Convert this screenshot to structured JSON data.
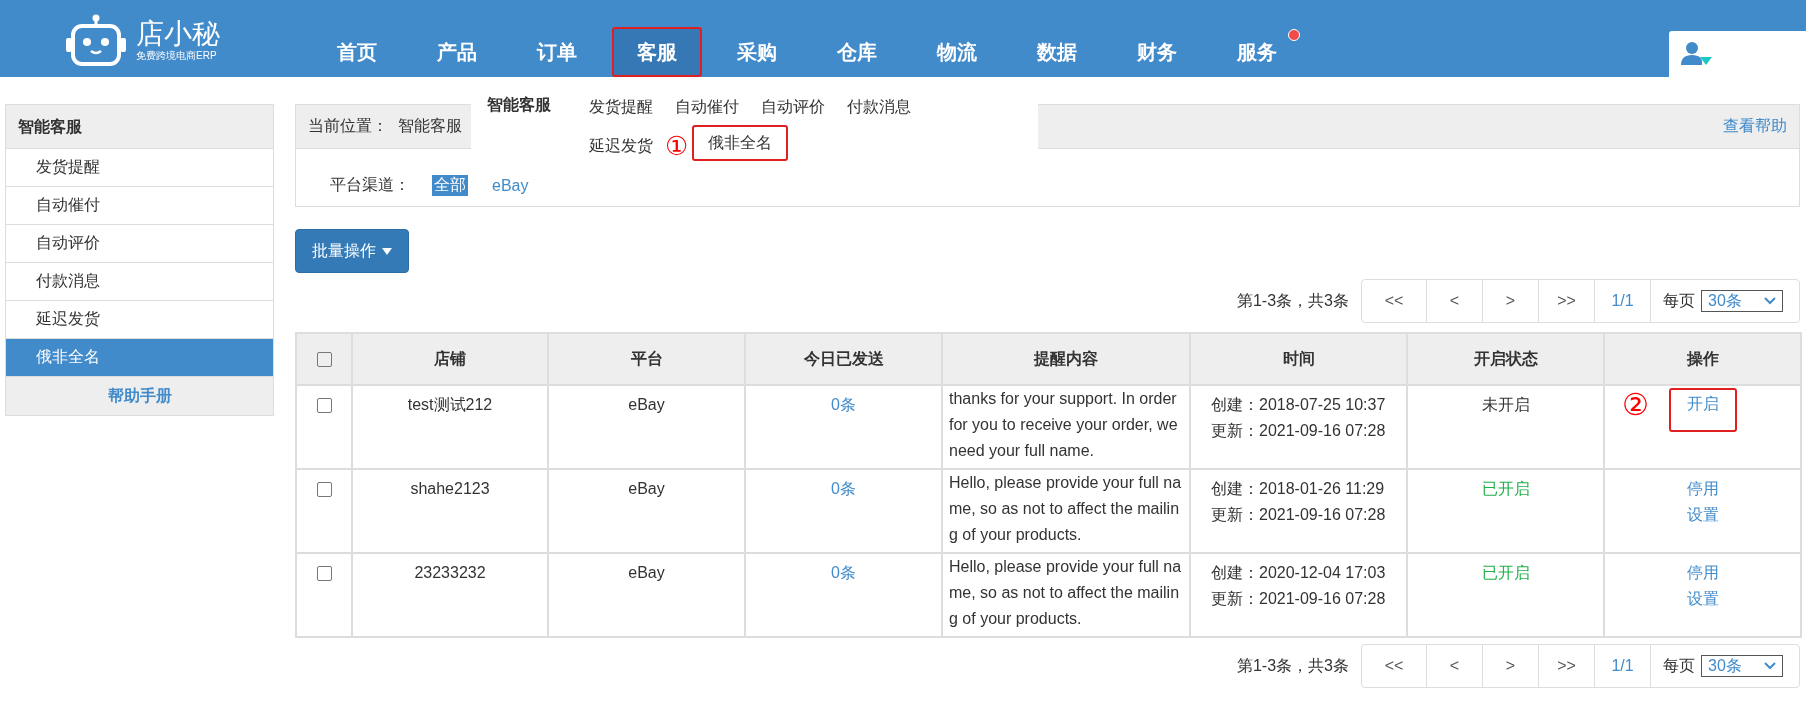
{
  "header": {
    "logo": {
      "name": "店小秘",
      "tagline": "免费跨境电商ERP"
    },
    "nav": [
      {
        "label": "首页",
        "selected": false,
        "badge": false,
        "highlight": false
      },
      {
        "label": "产品",
        "selected": false,
        "badge": false,
        "highlight": false
      },
      {
        "label": "订单",
        "selected": false,
        "badge": false,
        "highlight": false
      },
      {
        "label": "客服",
        "selected": true,
        "badge": false,
        "highlight": true
      },
      {
        "label": "采购",
        "selected": false,
        "badge": false,
        "highlight": false
      },
      {
        "label": "仓库",
        "selected": false,
        "badge": false,
        "highlight": false
      },
      {
        "label": "物流",
        "selected": false,
        "badge": false,
        "highlight": false
      },
      {
        "label": "数据",
        "selected": false,
        "badge": false,
        "highlight": false
      },
      {
        "label": "财务",
        "selected": false,
        "badge": false,
        "highlight": false
      },
      {
        "label": "服务",
        "selected": false,
        "badge": true,
        "highlight": false
      }
    ]
  },
  "dropdown": {
    "title": "智能客服",
    "items": [
      {
        "label": "发货提醒",
        "highlight": false
      },
      {
        "label": "自动催付",
        "highlight": false
      },
      {
        "label": "自动评价",
        "highlight": false
      },
      {
        "label": "付款消息",
        "highlight": false
      },
      {
        "label": "延迟发货",
        "highlight": false
      },
      {
        "label": "俄非全名",
        "highlight": true,
        "marker": "①"
      }
    ]
  },
  "sidebar": {
    "title": "智能客服",
    "items": [
      {
        "label": "发货提醒",
        "selected": false
      },
      {
        "label": "自动催付",
        "selected": false
      },
      {
        "label": "自动评价",
        "selected": false
      },
      {
        "label": "付款消息",
        "selected": false
      },
      {
        "label": "延迟发货",
        "selected": false
      },
      {
        "label": "俄非全名",
        "selected": true
      }
    ],
    "help": "帮助手册"
  },
  "breadcrumb": {
    "label": "当前位置：",
    "path": "智能客服",
    "help_link": "查看帮助"
  },
  "filter": {
    "label": "平台渠道：",
    "options": [
      {
        "label": "全部",
        "selected": true
      },
      {
        "label": "eBay",
        "selected": false
      }
    ]
  },
  "batch_button": "批量操作",
  "pagination_top": {
    "summary": "第1-3条，共3条",
    "buttons": [
      "<<",
      "<",
      ">",
      ">>"
    ],
    "page": "1/1",
    "per_page_label": "每页",
    "per_page": "30条"
  },
  "table": {
    "select_all": {
      "checked": false
    },
    "columns": [
      "店铺",
      "平台",
      "今日已发送",
      "提醒内容",
      "时间",
      "开启状态",
      "操作"
    ],
    "rows": [
      {
        "checked": false,
        "shop": "test测试212",
        "platform": "eBay",
        "sent": "0条",
        "content": "thanks for your support. In order for you to receive your order, we need your full name.",
        "created": "创建：2018-07-25 10:37",
        "updated": "更新：2021-09-16 07:28",
        "status": {
          "label": "未开启",
          "on": false
        },
        "actions": [
          {
            "label": "开启",
            "highlight": true,
            "marker": "②"
          }
        ]
      },
      {
        "checked": false,
        "shop": "shahe2123",
        "platform": "eBay",
        "sent": "0条",
        "content": "Hello, please provide your full name, so as not to affect the mailing of your products.",
        "created": "创建：2018-01-26 11:29",
        "updated": "更新：2021-09-16 07:28",
        "status": {
          "label": "已开启",
          "on": true
        },
        "actions": [
          {
            "label": "停用",
            "highlight": false
          },
          {
            "label": "设置",
            "highlight": false
          }
        ]
      },
      {
        "checked": false,
        "shop": "23233232",
        "platform": "eBay",
        "sent": "0条",
        "content": "Hello, please provide your full name, so as not to affect the mailing of your products.",
        "created": "创建：2020-12-04 17:03",
        "updated": "更新：2021-09-16 07:28",
        "status": {
          "label": "已开启",
          "on": true
        },
        "actions": [
          {
            "label": "停用",
            "highlight": false
          },
          {
            "label": "设置",
            "highlight": false
          }
        ]
      }
    ]
  },
  "pagination_bottom": {
    "summary": "第1-3条，共3条",
    "buttons": [
      "<<",
      "<",
      ">",
      ">>"
    ],
    "page": "1/1",
    "per_page_label": "每页",
    "per_page": "30条"
  }
}
